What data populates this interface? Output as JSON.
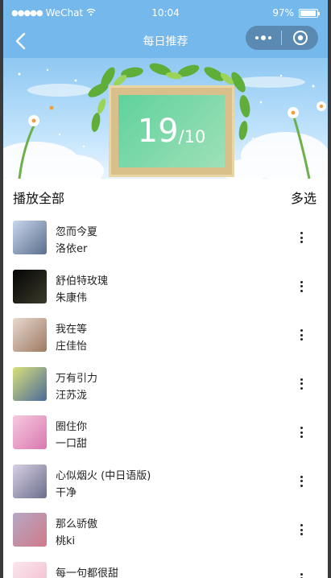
{
  "status_bar": {
    "carrier": "WeChat",
    "time": "10:04",
    "battery": "97%",
    "battery_level": 0.97
  },
  "nav": {
    "title": "每日推荐"
  },
  "banner": {
    "day": "19",
    "month": "/10"
  },
  "list_header": {
    "play_all": "播放全部",
    "multi_select": "多选"
  },
  "songs": [
    {
      "title": "忽而今夏",
      "artist": "洛依er",
      "cover_colors": [
        "#c9d6ec",
        "#5a6e8c"
      ]
    },
    {
      "title": "舒伯特玫瑰",
      "artist": "朱康伟",
      "cover_colors": [
        "#050505",
        "#3a3a2a"
      ]
    },
    {
      "title": "我在等",
      "artist": "庄佳怡",
      "cover_colors": [
        "#e8d8cf",
        "#9e7a62"
      ]
    },
    {
      "title": "万有引力",
      "artist": "汪苏泷",
      "cover_colors": [
        "#d9e07a",
        "#4a6a9a"
      ]
    },
    {
      "title": "圈住你",
      "artist": "一口甜",
      "cover_colors": [
        "#f7c9de",
        "#d978b0"
      ]
    },
    {
      "title": "心似烟火 (中日语版)",
      "artist": "干净",
      "cover_colors": [
        "#d8d0e4",
        "#6a6e8c"
      ]
    },
    {
      "title": "那么骄傲",
      "artist": "桃ki",
      "cover_colors": [
        "#b5a8c4",
        "#d07a8a"
      ]
    },
    {
      "title": "每一句都很甜",
      "artist": "",
      "cover_colors": [
        "#fbe6ee",
        "#f2b8cc"
      ]
    }
  ]
}
